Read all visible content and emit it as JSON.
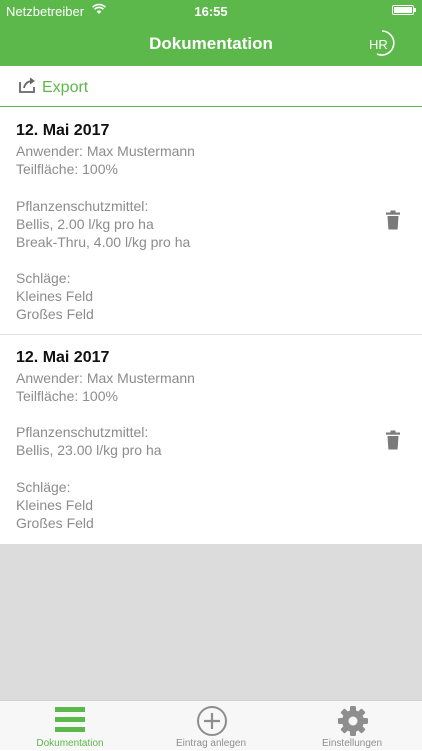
{
  "status_bar": {
    "carrier": "Netzbetreiber",
    "time": "16:55"
  },
  "header": {
    "title": "Dokumentation",
    "logo_text": "HR"
  },
  "toolbar": {
    "export_label": "Export"
  },
  "entries": [
    {
      "date": "12. Mai 2017",
      "user": "Anwender: Max Mustermann",
      "area": "Teilfläche: 100%",
      "agents_heading": "Pflanzenschutzmittel:",
      "agents": [
        "Bellis, 2.00 l/kg pro ha",
        "Break-Thru, 4.00 l/kg pro ha"
      ],
      "fields_heading": "Schläge:",
      "fields": [
        "Kleines Feld",
        "Großes Feld"
      ]
    },
    {
      "date": "12. Mai 2017",
      "user": "Anwender: Max Mustermann",
      "area": "Teilfläche: 100%",
      "agents_heading": "Pflanzenschutzmittel:",
      "agents": [
        "Bellis, 23.00 l/kg pro ha"
      ],
      "fields_heading": "Schläge:",
      "fields": [
        "Kleines Feld",
        "Großes Feld"
      ]
    }
  ],
  "tabbar": {
    "items": [
      {
        "label": "Dokumentation",
        "icon": "list-icon",
        "active": true
      },
      {
        "label": "Eintrag anlegen",
        "icon": "plus-circle-icon",
        "active": false
      },
      {
        "label": "Einstellungen",
        "icon": "gear-icon",
        "active": false
      }
    ]
  },
  "colors": {
    "accent": "#5cb84a",
    "text_muted": "#8c8c8c",
    "empty_area": "#dcdcdc"
  }
}
